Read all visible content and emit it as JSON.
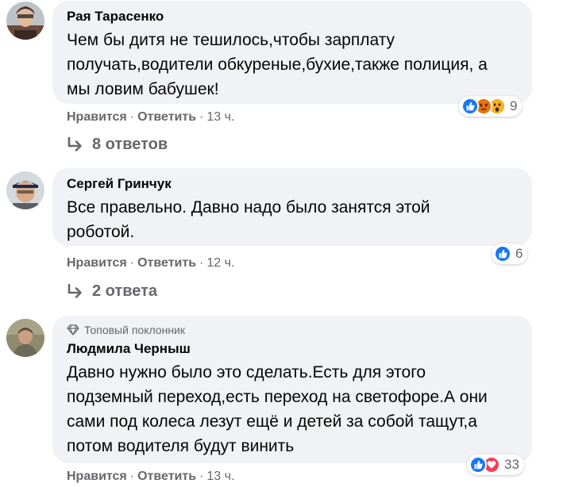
{
  "comments": [
    {
      "author": "Рая Тарасенко",
      "badge": "",
      "lines": [
        "Чем бы дитя не тешилось,чтобы зарплату",
        "получать,водители обкуреные,бухие,также полиция, а",
        "мы ловим бабушек!"
      ],
      "like_label": "Нравится",
      "reply_label": "Ответить",
      "time": "13 ч.",
      "reactions": [
        "like-icon",
        "angry-icon",
        "wow-icon"
      ],
      "reaction_count": "9",
      "replies_label": "8 ответов"
    },
    {
      "author": "Сергей Гринчук",
      "badge": "",
      "lines": [
        "Все правельно. Давно надо было занятся этой",
        "роботой."
      ],
      "like_label": "Нравится",
      "reply_label": "Ответить",
      "time": "12 ч.",
      "reactions": [
        "like-icon"
      ],
      "reaction_count": "6",
      "replies_label": "2 ответа"
    },
    {
      "author": "Людмила Черныш",
      "badge": "Топовый поклонник",
      "lines": [
        "Давно нужно было это сделать.Есть для этого",
        "подземный переход,есть переход на светофоре.А они",
        "сами под колеса лезут ещё и детей за собой тащут,а",
        "потом водителя будут винить"
      ],
      "like_label": "Нравится",
      "reply_label": "Ответить",
      "time": "13 ч.",
      "reactions": [
        "like-icon",
        "love-icon"
      ],
      "reaction_count": "33",
      "replies_label": ""
    }
  ],
  "colors": {
    "bubble": "#f0f2f5",
    "secondary_text": "#65676b",
    "like_blue": "#1877f2",
    "love_red": "#f33e58",
    "angry": "#e9710f",
    "wow": "#f7b125"
  }
}
